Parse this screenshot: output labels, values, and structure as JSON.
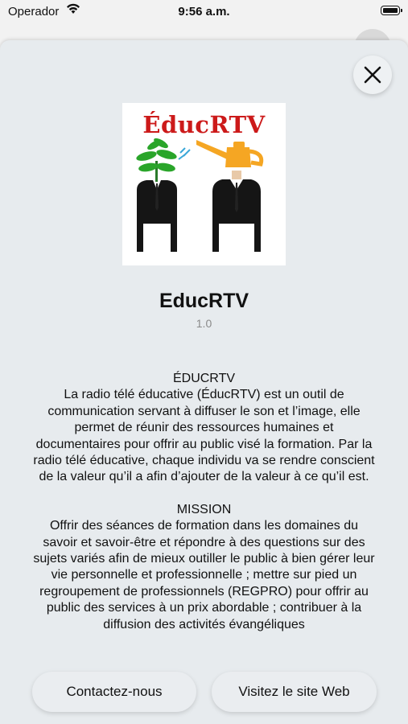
{
  "status_bar": {
    "carrier": "Operador",
    "time": "9:56 a.m."
  },
  "app": {
    "logo_text": "ÉducRTV",
    "name": "EducRTV",
    "version": "1.0"
  },
  "description": {
    "heading1": "ÉDUCRTV",
    "para1": "La radio télé éducative (ÉducRTV) est un outil de communication servant à diffuser le son et l’image, elle permet de réunir des ressources humaines et documentaires pour offrir au public visé la formation. Par la radio télé éducative, chaque individu va se rendre conscient de la valeur qu’il a afin d’ajouter de la valeur à ce qu’il est.",
    "heading2": "MISSION",
    "para2": "Offrir des séances de formation dans les domaines du savoir et savoir-être et répondre à des questions sur des sujets variés afin de mieux outiller le public à bien gérer leur vie personnelle et professionnelle ; mettre sur pied un regroupement de professionnels (REGPRO) pour offrir au public des services à un prix abordable ; contribuer à la diffusion des activités évangéliques"
  },
  "buttons": {
    "contact": "Contactez-nous",
    "website": "Visitez le site Web"
  },
  "colors": {
    "sheet": "#e7ebee",
    "logo_red": "#cc1a1a",
    "logo_orange": "#f5a623",
    "logo_green": "#2aa52a"
  }
}
